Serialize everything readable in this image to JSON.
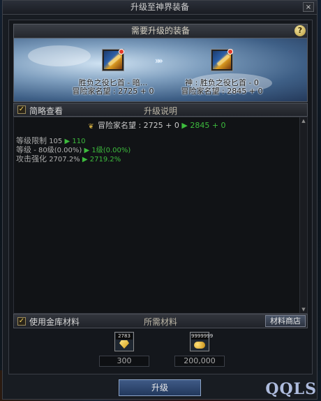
{
  "window": {
    "title": "升级至神界装备",
    "close_label": "×"
  },
  "required_section": {
    "title": "需要升级的装备",
    "help_label": "?"
  },
  "items": {
    "source": {
      "name": "胜负之役匕首 - 暗...",
      "reputation": "冒险家名望 : 2725 + 0"
    },
    "arrow": "»»",
    "target": {
      "name": "神 : 胜负之役匕首 - 0",
      "reputation": "冒险家名望 : 2845 + 0"
    }
  },
  "brief_view": {
    "label": "简略查看",
    "checked": true,
    "checkmark": "✓"
  },
  "upgrade_desc": {
    "title": "升级说明",
    "rank_icon": "crest-icon",
    "rank_prefix": "冒险家名望 : 2725 + 0",
    "rank_arrow": "▶",
    "rank_new": "2845 + 0",
    "stats": [
      {
        "name": "等级限制",
        "old": "105",
        "new": "110"
      },
      {
        "name": "等级",
        "old": "- 80级(0.00%)",
        "new": "1级(0.00%)"
      },
      {
        "name": "攻击强化",
        "old": "2707.2%",
        "new": "2719.2%"
      }
    ],
    "arrow": "▶",
    "scroll_up": "▲",
    "scroll_down": "▼"
  },
  "materials": {
    "use_storage_label": "使用金库材料",
    "use_storage_checked": true,
    "title": "所需材料",
    "shop_label": "材料商店",
    "list": [
      {
        "icon": "gem-icon",
        "count": "2783",
        "required": "300"
      },
      {
        "icon": "gold-coins-icon",
        "count": "9999999",
        "required": "200,000"
      }
    ]
  },
  "confirm_button": "升级",
  "watermark": "QQLS",
  "colors": {
    "upgrade_arrow": "#3dbb3d",
    "button": "#2f4a75"
  }
}
